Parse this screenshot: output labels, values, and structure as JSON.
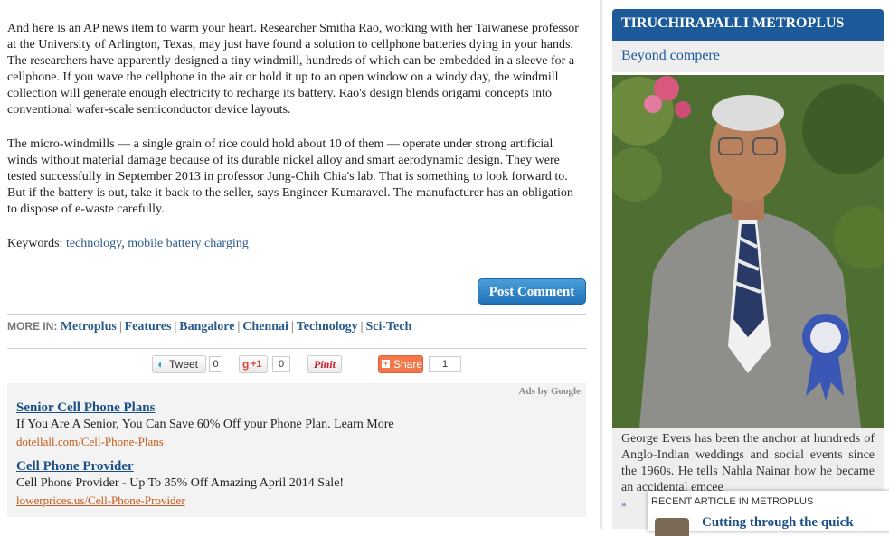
{
  "article": {
    "paragraph1": "And here is an AP news item to warm your heart. Researcher Smitha Rao, working with her Taiwanese professor at the University of Arlington, Texas, may just have found a solution to cellphone batteries dying in your hands. The researchers have apparently designed a tiny windmill, hundreds of which can be embedded in a sleeve for a cellphone. If you wave the cellphone in the air or hold it up to an open window on a windy day, the windmill collection will generate enough electricity to recharge its battery. Rao's design blends origami concepts into conventional wafer-scale semiconductor device layouts.",
    "paragraph2": "The micro-windmills — a single grain of rice could hold about 10 of them — operate under strong artificial winds without material damage because of its durable nickel alloy and smart aerodynamic design. They were tested successfully in September 2013 in professor Jung-Chih Chia's lab. That is something to look forward to. But if the battery is out, take it back to the seller, says Engineer Kumaravel. The manufacturer has an obligation to dispose of e-waste carefully.",
    "keywords_label": "Keywords:",
    "keywords": [
      "technology",
      "mobile battery charging"
    ]
  },
  "post_comment_label": "Post Comment",
  "more_in": {
    "label": "MORE IN:",
    "links": [
      "Metroplus",
      "Features",
      "Bangalore",
      "Chennai",
      "Technology",
      "Sci-Tech"
    ]
  },
  "share": {
    "tweet_label": "Tweet",
    "tweet_count": "0",
    "gplus_label": "+1",
    "gplus_count": "0",
    "pinit_label": "Pinit",
    "share_label": "Share",
    "share_count": "1"
  },
  "ads": {
    "by_label": "Ads by Google",
    "items": [
      {
        "title": "Senior Cell Phone Plans",
        "text": "If You Are A Senior, You Can Save 60% Off your Phone Plan. Learn More",
        "url": "dotellall.com/Cell-Phone-Plans"
      },
      {
        "title": "Cell Phone Provider",
        "text": "Cell Phone Provider - Up To 35% Off Amazing April 2014 Sale!",
        "url": "lowerprices.us/Cell-Phone-Provider"
      }
    ]
  },
  "sidebar": {
    "header": "TIRUCHIRAPALLI METROPLUS",
    "subheader": "Beyond compere",
    "caption": "George Evers has been the anchor at hundreds of Anglo-Indian weddings and social events since the 1960s. He tells Nahla Nainar how he became an accidental emcee",
    "more_arrow": "»"
  },
  "recent": {
    "label": "RECENT ARTICLE IN METROPLUS",
    "title": "Cutting through the quick"
  },
  "colors": {
    "accent": "#1d5a99",
    "link": "#2a5b8c",
    "ad_url": "#c45a1a",
    "button": "#2a84c8"
  }
}
